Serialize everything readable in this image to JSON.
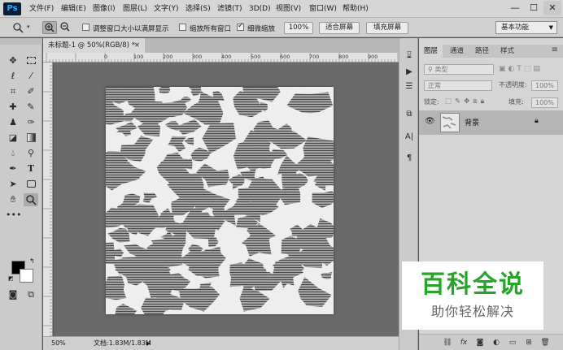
{
  "app": {
    "logo": "Ps"
  },
  "menu": [
    "文件(F)",
    "编辑(E)",
    "图像(I)",
    "图层(L)",
    "文字(Y)",
    "选择(S)",
    "滤镜(T)",
    "3D(D)",
    "视图(V)",
    "窗口(W)",
    "帮助(H)"
  ],
  "window_controls": {
    "minimize": "—",
    "maximize": "☐",
    "close": "✕"
  },
  "options": {
    "zoom_tool_icon": "zoom-icon",
    "resize_windows_label": "调整窗口大小以满屏显示",
    "resize_windows_checked": false,
    "zoom_all_windows_label": "缩放所有窗口",
    "zoom_all_windows_checked": false,
    "scrubby_zoom_label": "细微缩放",
    "scrubby_zoom_checked": true,
    "zoom_value": "100%",
    "fit_screen_label": "适合屏幕",
    "fill_screen_label": "填充屏幕",
    "workspace": "基本功能"
  },
  "document": {
    "tab_title": "未标题-1 @ 50%(RGB/8) *",
    "tab_close": "×",
    "ruler_labels": [
      "0",
      "100",
      "200",
      "300",
      "400",
      "500",
      "600",
      "700",
      "800",
      "900"
    ],
    "status_zoom": "50%",
    "status_doc": "文档:1.83M/1.83M",
    "status_arrow": "▶"
  },
  "layers_panel": {
    "tabs": [
      "图层",
      "通道",
      "路径",
      "样式"
    ],
    "active_tab": "图层",
    "kind_label": "类型",
    "blend_mode": "正常",
    "opacity_label": "不透明度:",
    "opacity_value": "100%",
    "lock_label": "锁定:",
    "fill_label": "填充:",
    "fill_value": "100%",
    "layers": [
      {
        "name": "背景",
        "visible": true,
        "locked": true
      }
    ],
    "footer_icons": [
      "link-icon",
      "fx-icon",
      "mask-icon",
      "adjustment-icon",
      "group-icon",
      "new-layer-icon",
      "trash-icon"
    ]
  },
  "watermark": {
    "title": "百科全说",
    "subtitle": "助你轻松解决"
  },
  "colors": {
    "foreground": "#000000",
    "background": "#ffffff",
    "accent_watermark": "#26a52a"
  }
}
